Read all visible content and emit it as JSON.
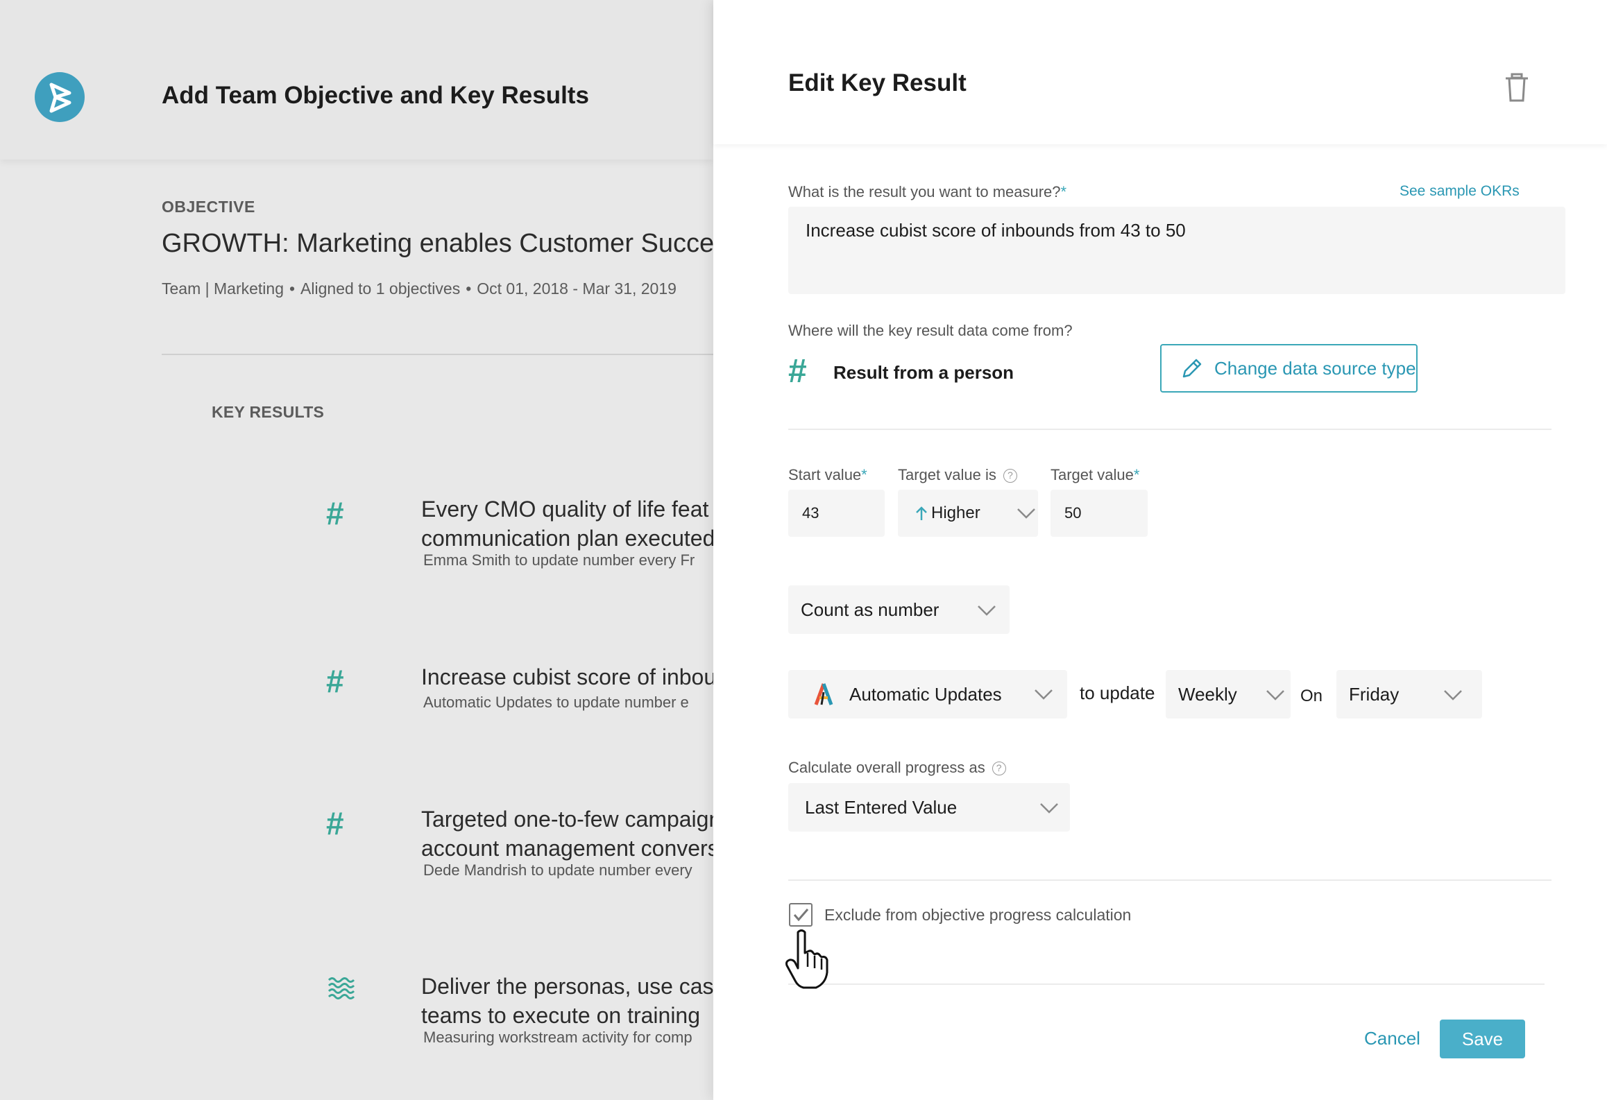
{
  "background": {
    "page_title": "Add Team Objective and Key Results",
    "objective_label": "OBJECTIVE",
    "objective_title": "GROWTH: Marketing enables Customer Success",
    "meta": {
      "team": "Team | Marketing",
      "aligned": "Aligned to 1 objectives",
      "dates": "Oct 01, 2018 - Mar 31, 2019"
    },
    "key_results_label": "KEY RESULTS",
    "key_results": [
      {
        "icon": "hash-icon",
        "line1": "Every CMO quality of life feat",
        "line2": "communication plan executed",
        "sub": "Emma Smith to update number every Fr"
      },
      {
        "icon": "hash-icon",
        "line1": "Increase cubist score of inbou",
        "line2": "",
        "sub": "Automatic Updates to update number e"
      },
      {
        "icon": "hash-icon",
        "line1": "Targeted one-to-few campaign",
        "line2": "account management convers",
        "sub": "Dede Mandrish to update number every"
      },
      {
        "icon": "waves-icon",
        "line1": "Deliver the personas, use case",
        "line2": "teams to execute on training",
        "sub": "Measuring workstream activity for comp"
      }
    ]
  },
  "drawer": {
    "title": "Edit Key Result",
    "measure_label": "What is the result you want to measure?",
    "required_mark": "*",
    "sample_link": "See sample OKRs",
    "measure_value": "Increase cubist score of inbounds from 43 to 50",
    "source_label": "Where will the key result data come from?",
    "source_value": "Result from a person",
    "change_source_button": "Change data source type",
    "start_value_label": "Start value",
    "target_is_label": "Target value is",
    "target_value_label": "Target value",
    "start_value": "43",
    "target_direction": "Higher",
    "target_value": "50",
    "count_as": "Count as number",
    "update_source": "Automatic Updates",
    "to_update_label": "to update",
    "frequency": "Weekly",
    "on_label": "On",
    "day": "Friday",
    "progress_label": "Calculate overall progress as",
    "progress_value": "Last Entered Value",
    "exclude_label": "Exclude from objective progress calculation",
    "exclude_checked": true,
    "cancel_label": "Cancel",
    "save_label": "Save"
  },
  "colors": {
    "accent": "#3aa7b8",
    "teal_icon": "#3aa797",
    "save_button": "#4aafc9",
    "logo": "#3f9fbe"
  }
}
